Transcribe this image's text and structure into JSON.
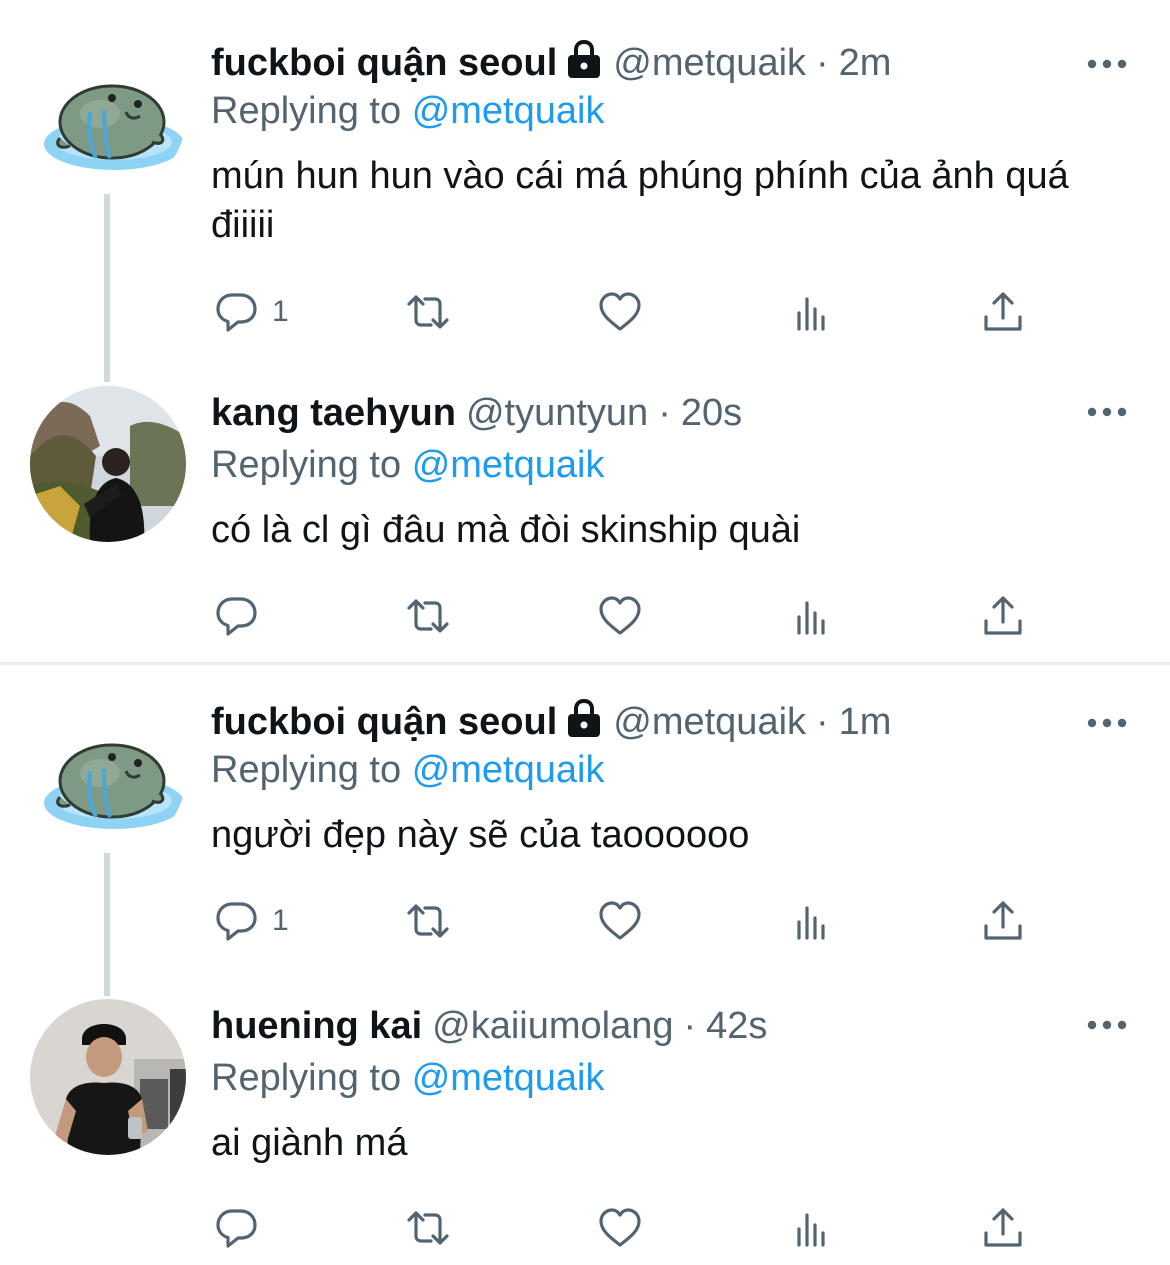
{
  "threads": [
    {
      "parent": {
        "name": "fuckboi quận seoul",
        "handle": "@metquaik",
        "time": "2m",
        "replying_prefix": "Replying to",
        "replying_handle": "@metquaik",
        "text": "mún hun hun vào cái má phúng phính của ảnh quá điiiii",
        "reply_count": "1",
        "protected": true
      },
      "reply": {
        "name": "kang taehyun",
        "handle": "@tyuntyun",
        "time": "20s",
        "replying_prefix": "Replying to",
        "replying_handle": "@metquaik",
        "text": "có là cl gì đâu mà đòi skinship quài",
        "reply_count": ""
      }
    },
    {
      "parent": {
        "name": "fuckboi quận seoul",
        "handle": "@metquaik",
        "time": "1m",
        "replying_prefix": "Replying to",
        "replying_handle": "@metquaik",
        "text": "người đẹp này sẽ của taoooooo",
        "reply_count": "1",
        "protected": true
      },
      "reply": {
        "name": "huening kai",
        "handle": "@kaiiumolang",
        "time": "42s",
        "replying_prefix": "Replying to",
        "replying_handle": "@metquaik",
        "text": "ai giành má",
        "reply_count": ""
      }
    }
  ],
  "separator": "·",
  "icons": {
    "reply": "reply-icon",
    "retweet": "retweet-icon",
    "like": "like-icon",
    "views": "views-icon",
    "share": "share-icon",
    "more": "more-icon",
    "lock": "lock-icon"
  },
  "colors": {
    "link": "#1d9bf0",
    "secondary": "#536471",
    "text": "#0f1419",
    "thread_line": "#cfd9de"
  }
}
